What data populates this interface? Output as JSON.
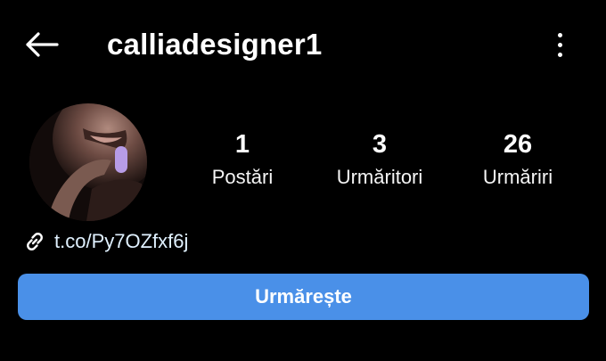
{
  "header": {
    "username": "calliadesigner1"
  },
  "stats": [
    {
      "value": "1",
      "label": "Postări"
    },
    {
      "value": "3",
      "label": "Urmăritori"
    },
    {
      "value": "26",
      "label": "Urmăriri"
    }
  ],
  "profile": {
    "link": "t.co/Py7OZfxf6j"
  },
  "actions": {
    "follow_label": "Urmărește"
  },
  "colors": {
    "background": "#000000",
    "text": "#ffffff",
    "follow_button": "#4a90e8"
  },
  "icons": {
    "back": "arrow-left-icon",
    "menu": "more-vertical-icon",
    "link": "link-icon"
  }
}
